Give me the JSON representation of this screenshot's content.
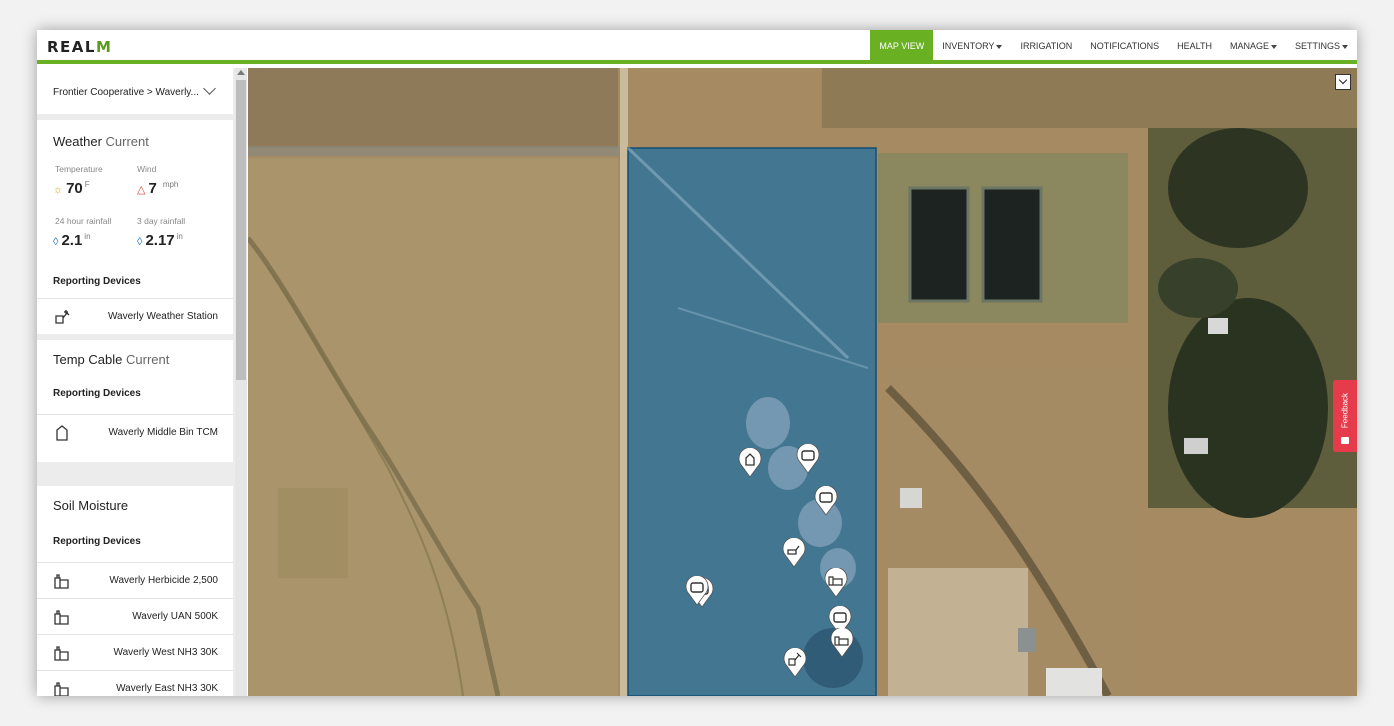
{
  "app": {
    "logo_main": "REAL",
    "logo_accent": "M"
  },
  "nav": [
    {
      "label": "MAP VIEW",
      "active": true,
      "dropdown": false
    },
    {
      "label": "INVENTORY",
      "active": false,
      "dropdown": true
    },
    {
      "label": "IRRIGATION",
      "active": false,
      "dropdown": false
    },
    {
      "label": "NOTIFICATIONS",
      "active": false,
      "dropdown": false
    },
    {
      "label": "HEALTH",
      "active": false,
      "dropdown": false
    },
    {
      "label": "MANAGE",
      "active": false,
      "dropdown": true
    },
    {
      "label": "SETTINGS",
      "active": false,
      "dropdown": true
    }
  ],
  "sidebar": {
    "breadcrumb": "Frontier Cooperative > Waverly...",
    "weather": {
      "title": "Weather",
      "subtitle": "Current",
      "temperature_label": "Temperature",
      "temperature_value": "70",
      "temperature_unit": "F",
      "wind_label": "Wind",
      "wind_value": "7",
      "wind_unit": "mph",
      "rain24_label": "24 hour rainfall",
      "rain24_value": "2.1",
      "rain24_unit": "in",
      "rain3d_label": "3 day rainfall",
      "rain3d_value": "2.17",
      "rain3d_unit": "in",
      "reporting_label": "Reporting Devices",
      "devices": [
        "Waverly Weather Station"
      ]
    },
    "temp_cable": {
      "title": "Temp Cable",
      "subtitle": "Current",
      "reporting_label": "Reporting Devices",
      "devices": [
        "Waverly Middle Bin TCM"
      ]
    },
    "soil": {
      "title": "Soil Moisture",
      "reporting_label": "Reporting Devices",
      "devices": [
        "Waverly Herbicide 2,500",
        "Waverly UAN 500K",
        "Waverly West NH3 30K",
        "Waverly East NH3 30K"
      ]
    }
  },
  "map": {
    "feedback_label": "Feedback",
    "overlay_color": "#1d6fa3"
  }
}
